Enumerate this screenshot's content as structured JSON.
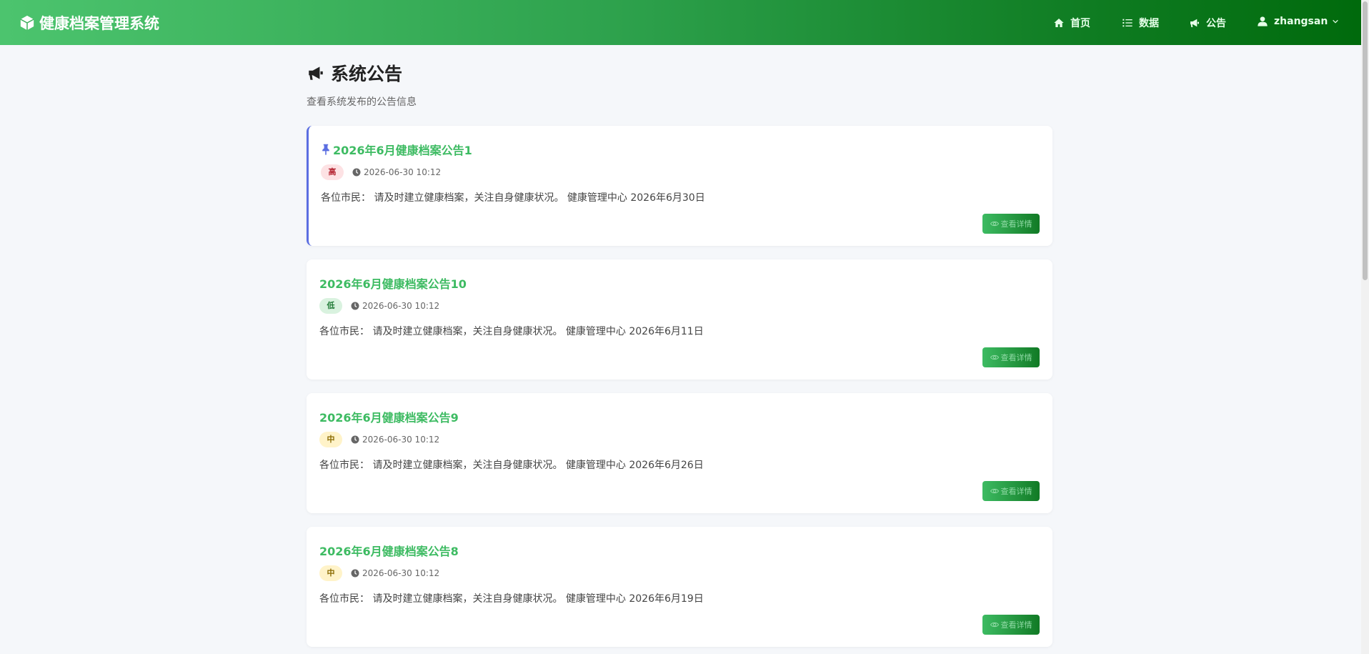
{
  "brand": {
    "title": "健康档案管理系统",
    "icon": "cube-icon"
  },
  "nav": {
    "home": {
      "label": "首页",
      "icon": "home-icon"
    },
    "data": {
      "label": "数据",
      "icon": "list-icon"
    },
    "notice": {
      "label": "公告",
      "icon": "bullhorn-icon"
    },
    "user": {
      "label": "zhangsan",
      "icon": "user-icon"
    }
  },
  "page": {
    "title": "系统公告",
    "subtitle": "查看系统发布的公告信息"
  },
  "colors": {
    "accent": "#3dbb62",
    "header_gradient_start": "#4cc46e",
    "header_gradient_end": "#006a0c",
    "pin": "#5b6ee1"
  },
  "notices": [
    {
      "title": "2026年6月健康档案公告1",
      "pinned": true,
      "priority": "高",
      "time": "2026-06-30 10:12",
      "content": "各位市民： 请及时建立健康档案，关注自身健康状况。 健康管理中心 2026年6月30日",
      "action": "查看详情"
    },
    {
      "title": "2026年6月健康档案公告10",
      "pinned": false,
      "priority": "低",
      "time": "2026-06-30 10:12",
      "content": "各位市民： 请及时建立健康档案，关注自身健康状况。 健康管理中心 2026年6月11日",
      "action": "查看详情"
    },
    {
      "title": "2026年6月健康档案公告9",
      "pinned": false,
      "priority": "中",
      "time": "2026-06-30 10:12",
      "content": "各位市民： 请及时建立健康档案，关注自身健康状况。 健康管理中心 2026年6月26日",
      "action": "查看详情"
    },
    {
      "title": "2026年6月健康档案公告8",
      "pinned": false,
      "priority": "中",
      "time": "2026-06-30 10:12",
      "content": "各位市民： 请及时建立健康档案，关注自身健康状况。 健康管理中心 2026年6月19日",
      "action": "查看详情"
    }
  ]
}
